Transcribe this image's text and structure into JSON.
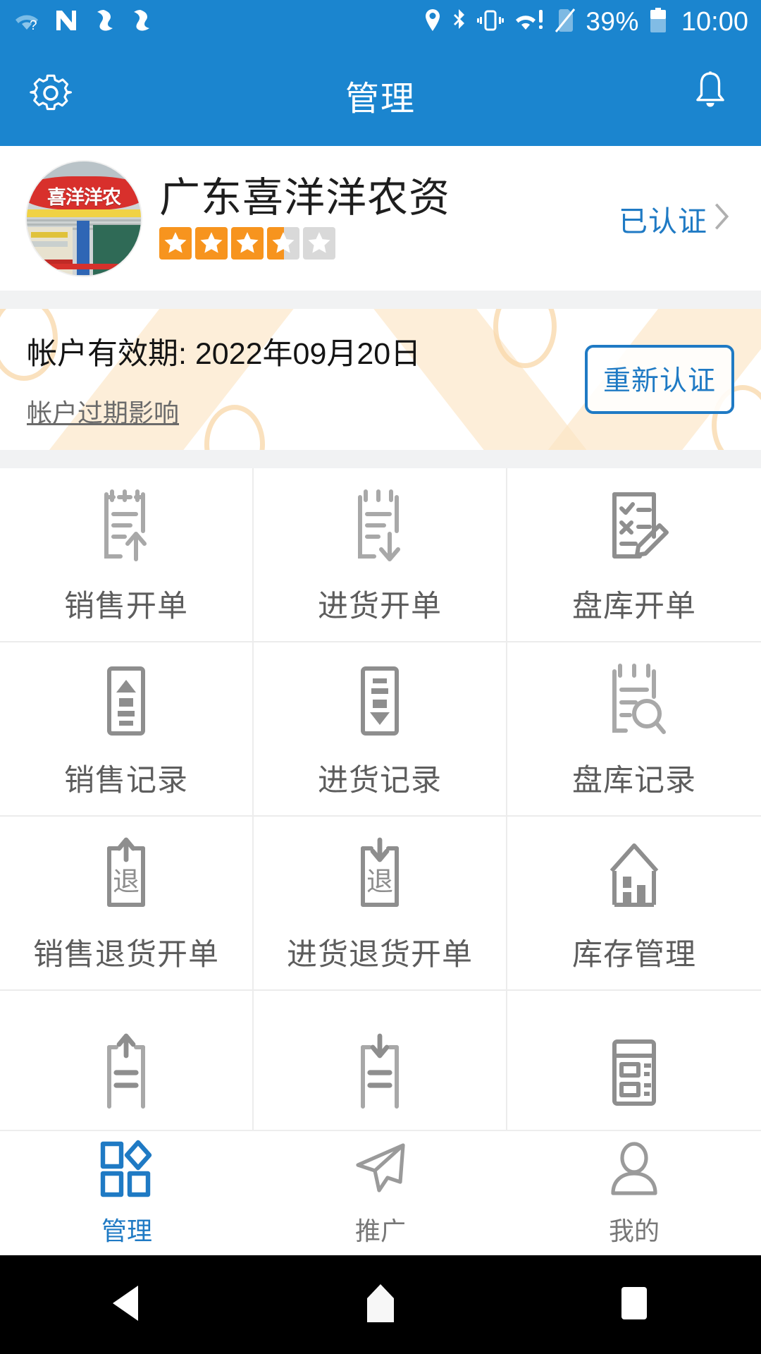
{
  "statusbar": {
    "icons_left": [
      "wifi-question-icon",
      "n-logo-icon",
      "sync-icon",
      "sync-icon-2"
    ],
    "icons_right": [
      "location-icon",
      "bluetooth-icon",
      "vibrate-icon",
      "wifi-alert-icon",
      "sim-off-icon"
    ],
    "battery_percent": "39%",
    "time": "10:00"
  },
  "appbar": {
    "title": "管理",
    "left_icon": "gear-icon",
    "right_icon": "bell-icon",
    "background": "#1b85cf"
  },
  "profile": {
    "avatar_sign_text": "喜洋洋农",
    "shop_name": "广东喜洋洋农资",
    "rating": 3.5,
    "rating_max": 5,
    "star_filled_color": "#f7941e",
    "star_empty_color": "#d9d9d9",
    "verify_label": "已认证",
    "verify_color": "#1f7ac4",
    "chevron_icon": "chevron-right-icon"
  },
  "validity": {
    "date_label": "帐户有效期: 2022年09月20日",
    "expire_link": "帐户过期影响",
    "recert_button": "重新认证",
    "accent": "#1f7ac4",
    "deco_color": "#fbe3c2"
  },
  "grid": {
    "items": [
      {
        "label": "销售开单",
        "icon": "clipboard-up-arrow-icon"
      },
      {
        "label": "进货开单",
        "icon": "clipboard-down-arrow-icon"
      },
      {
        "label": "盘库开单",
        "icon": "checklist-pencil-icon"
      },
      {
        "label": "销售记录",
        "icon": "box-up-triangle-icon"
      },
      {
        "label": "进货记录",
        "icon": "box-down-triangle-icon"
      },
      {
        "label": "盘库记录",
        "icon": "clipboard-search-icon"
      },
      {
        "label": "销售退货开单",
        "icon": "return-up-icon"
      },
      {
        "label": "进货退货开单",
        "icon": "return-down-icon"
      },
      {
        "label": "库存管理",
        "icon": "warehouse-icon"
      },
      {
        "label": "",
        "icon": "doc-up-arrow-icon"
      },
      {
        "label": "",
        "icon": "doc-down-arrow-icon"
      },
      {
        "label": "",
        "icon": "report-list-icon"
      }
    ]
  },
  "tabbar": {
    "tabs": [
      {
        "label": "管理",
        "icon": "grid-diamond-icon",
        "active": true
      },
      {
        "label": "推广",
        "icon": "paper-plane-icon",
        "active": false
      },
      {
        "label": "我的",
        "icon": "person-icon",
        "active": false
      }
    ],
    "active_color": "#1f7ac4",
    "inactive_color": "#777777"
  },
  "navbar": {
    "back": "back-triangle-icon",
    "home": "home-pentagon-icon",
    "recents": "recents-square-icon"
  }
}
